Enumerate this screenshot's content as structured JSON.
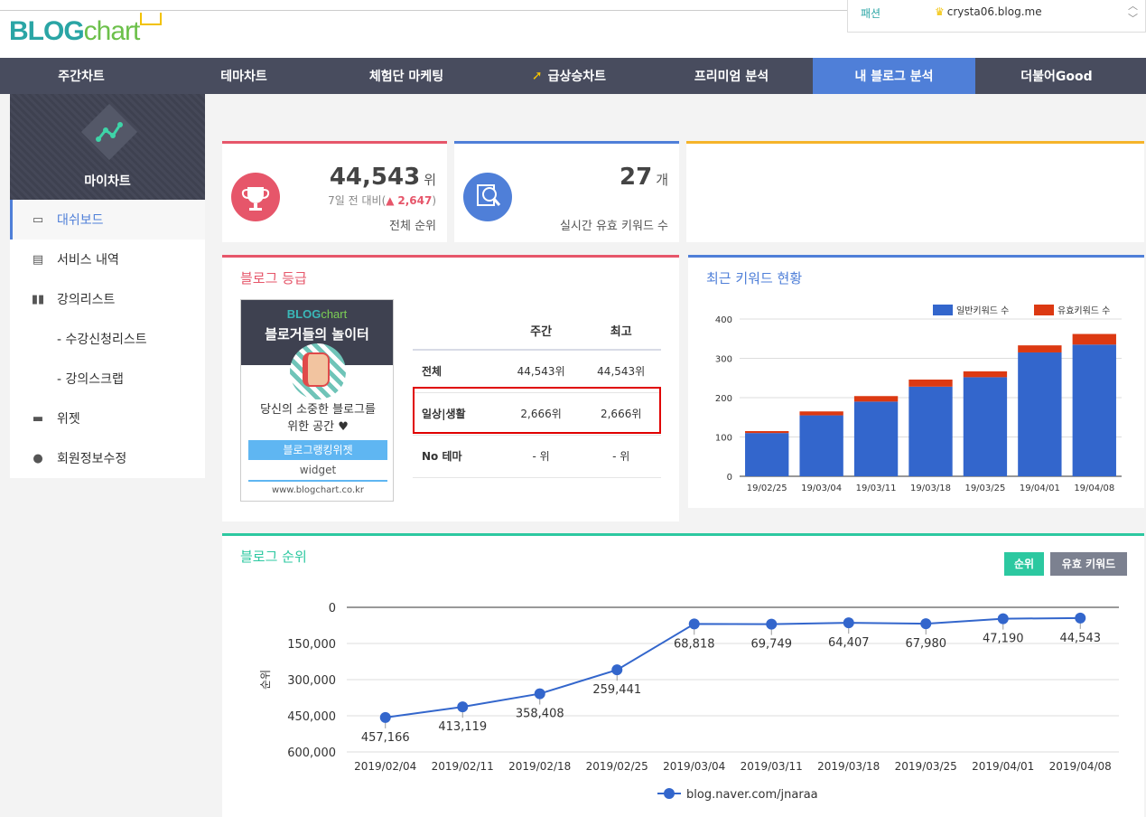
{
  "header": {
    "logo_blog": "BLOG",
    "logo_chart": "chart",
    "blog_category": "패션",
    "blog_url": "crysta06.blog.me"
  },
  "nav": {
    "items": [
      {
        "label": "주간차트"
      },
      {
        "label": "테마차트"
      },
      {
        "label": "체험단 마케팅"
      },
      {
        "label": "급상승차트"
      },
      {
        "label": "프리미엄 분석"
      },
      {
        "label": "내 블로그 분석",
        "active": true
      },
      {
        "label": "더불어Good"
      }
    ]
  },
  "sidebar": {
    "title": "마이차트",
    "items": [
      {
        "label": "대쉬보드",
        "icon": "monitor-icon"
      },
      {
        "label": "서비스 내역",
        "icon": "receipt-icon"
      },
      {
        "label": "강의리스트",
        "icon": "book-icon"
      },
      {
        "label": "- 수강신청리스트"
      },
      {
        "label": "- 강의스크랩"
      },
      {
        "label": "위젯",
        "icon": "widget-icon"
      },
      {
        "label": "회원정보수정",
        "icon": "user-icon"
      }
    ]
  },
  "rank_card": {
    "value": "44,543",
    "unit": "위",
    "compare_prefix": "7일 전 대비(",
    "compare_arrow": "▲",
    "compare_value": "2,647",
    "compare_suffix": ")",
    "caption": "전체 순위"
  },
  "kw_card": {
    "value": "27",
    "unit": "개",
    "caption": "실시간 유효 키워드 수"
  },
  "grade_card": {
    "title": "블로그 등급",
    "widget": {
      "logo_blog": "BLOG",
      "logo_chart": "chart",
      "slogan": "블로거들의 놀이터",
      "desc_line1": "당신의 소중한 블로그를",
      "desc_line2": "위한 공간 ♥",
      "button": "블로그랭킹위젯",
      "sub": "widget",
      "site": "www.blogchart.co.kr"
    },
    "table": {
      "headers": [
        "",
        "주간",
        "최고"
      ],
      "rows": [
        {
          "label": "전체",
          "weekly": "44,543위",
          "best": "44,543위"
        },
        {
          "label": "일상|생활",
          "weekly": "2,666위",
          "best": "2,666위"
        },
        {
          "label": "No 테마",
          "weekly": "- 위",
          "best": "- 위"
        }
      ]
    }
  },
  "keyword_chart": {
    "title": "최근 키워드 현황",
    "chart_data": {
      "type": "bar",
      "stacked": true,
      "categories": [
        "19/02/25",
        "19/03/04",
        "19/03/11",
        "19/03/18",
        "19/03/25",
        "19/04/01",
        "19/04/08"
      ],
      "series": [
        {
          "name": "일반키워드 수",
          "color": "#3366cc",
          "values": [
            110,
            155,
            190,
            228,
            252,
            315,
            335
          ]
        },
        {
          "name": "유효키워드 수",
          "color": "#dc3912",
          "values": [
            5,
            10,
            14,
            18,
            15,
            18,
            27
          ]
        }
      ],
      "ylim": [
        0,
        400
      ],
      "yticks": [
        0,
        100,
        200,
        300,
        400
      ],
      "legend": "top-right",
      "grid": true
    }
  },
  "rank_chart": {
    "title": "블로그 순위",
    "btn_rank": "순위",
    "btn_kw": "유효 키워드",
    "chart_data": {
      "type": "line",
      "x": [
        "2019/02/04",
        "2019/02/11",
        "2019/02/18",
        "2019/02/25",
        "2019/03/04",
        "2019/03/11",
        "2019/03/18",
        "2019/03/25",
        "2019/04/01",
        "2019/04/08"
      ],
      "series": [
        {
          "name": "blog.naver.com/jnaraa",
          "color": "#3366cc",
          "values": [
            457166,
            413119,
            358408,
            259441,
            68818,
            69749,
            64407,
            67980,
            47190,
            44543
          ]
        }
      ],
      "point_labels": [
        "457,166",
        "413,119",
        "358,408",
        "259,441",
        "68,818",
        "69,749",
        "64,407",
        "67,980",
        "47,190",
        "44,543"
      ],
      "ylabel": "순위",
      "yticks": [
        "0",
        "150,000",
        "300,000",
        "450,000",
        "600,000"
      ],
      "ylim": [
        0,
        600000
      ],
      "y_inverted": true,
      "legend": "bottom",
      "grid": true
    }
  }
}
